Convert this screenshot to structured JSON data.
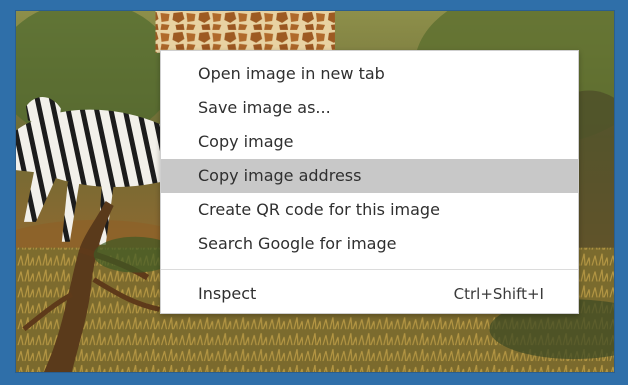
{
  "context_menu": {
    "items": [
      {
        "label": "Open image in new tab",
        "shortcut": "",
        "highlighted": false
      },
      {
        "label": "Save image as...",
        "shortcut": "",
        "highlighted": false
      },
      {
        "label": "Copy image",
        "shortcut": "",
        "highlighted": false
      },
      {
        "label": "Copy image address",
        "shortcut": "",
        "highlighted": true
      },
      {
        "label": "Create QR code for this image",
        "shortcut": "",
        "highlighted": false
      },
      {
        "label": "Search Google for image",
        "shortcut": "",
        "highlighted": false
      },
      {
        "label": "Inspect",
        "shortcut": "Ctrl+Shift+I",
        "highlighted": false
      }
    ]
  },
  "colors": {
    "frame_border": "#2f6fa9",
    "menu_background": "#ffffff",
    "menu_highlight": "#c8c8c8",
    "menu_text": "#2f2f2f"
  }
}
